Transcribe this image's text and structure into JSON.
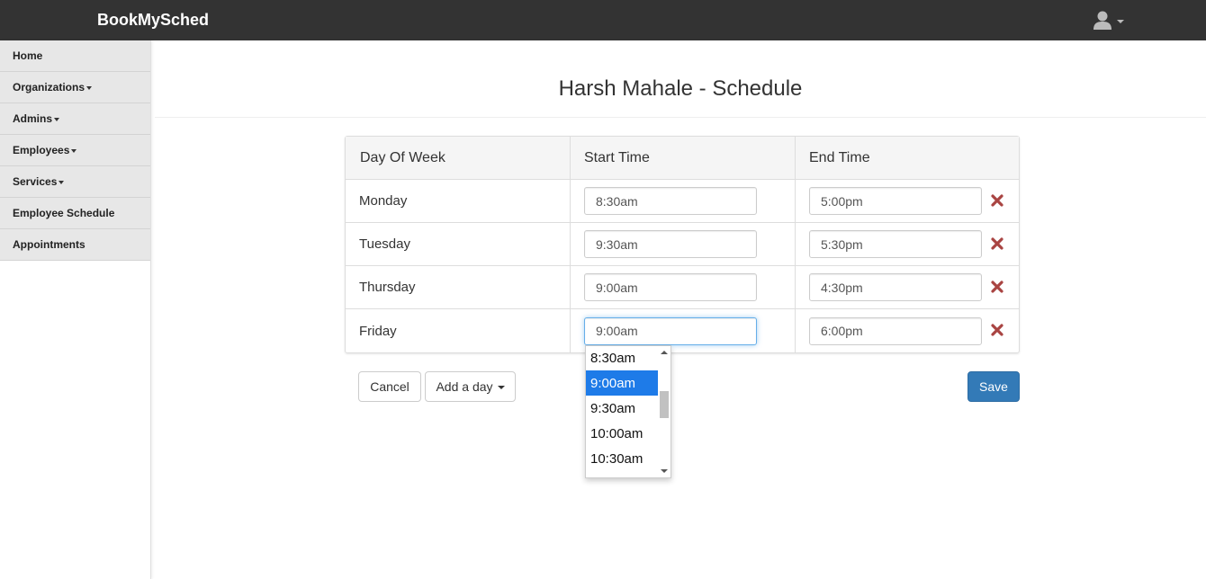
{
  "navbar": {
    "brand": "BookMySched",
    "user_icon": "user-silhouette-icon"
  },
  "sidebar": {
    "items": [
      {
        "label": "Home",
        "has_caret": false
      },
      {
        "label": "Organizations",
        "has_caret": true
      },
      {
        "label": "Admins",
        "has_caret": true
      },
      {
        "label": "Employees",
        "has_caret": true
      },
      {
        "label": "Services",
        "has_caret": true
      },
      {
        "label": "Employee Schedule",
        "has_caret": false
      },
      {
        "label": "Appointments",
        "has_caret": false
      }
    ]
  },
  "page": {
    "title": "Harsh Mahale - Schedule"
  },
  "table": {
    "headers": [
      "Day Of Week",
      "Start Time",
      "End Time"
    ],
    "rows": [
      {
        "day": "Monday",
        "start": "8:30am",
        "end": "5:00pm"
      },
      {
        "day": "Tuesday",
        "start": "9:30am",
        "end": "5:30pm"
      },
      {
        "day": "Thursday",
        "start": "9:00am",
        "end": "4:30pm"
      },
      {
        "day": "Friday",
        "start": "9:00am",
        "end": "6:00pm"
      }
    ],
    "remove_icon": "times-icon",
    "remove_color": "#a94442"
  },
  "time_dropdown": {
    "options": [
      "8:30am",
      "9:00am",
      "9:30am",
      "10:00am",
      "10:30am"
    ],
    "selected": "9:00am",
    "highlight_color": "#1e7be8"
  },
  "actions": {
    "cancel_label": "Cancel",
    "add_day_label": "Add a day",
    "save_label": "Save",
    "save_color": "#337ab7"
  }
}
